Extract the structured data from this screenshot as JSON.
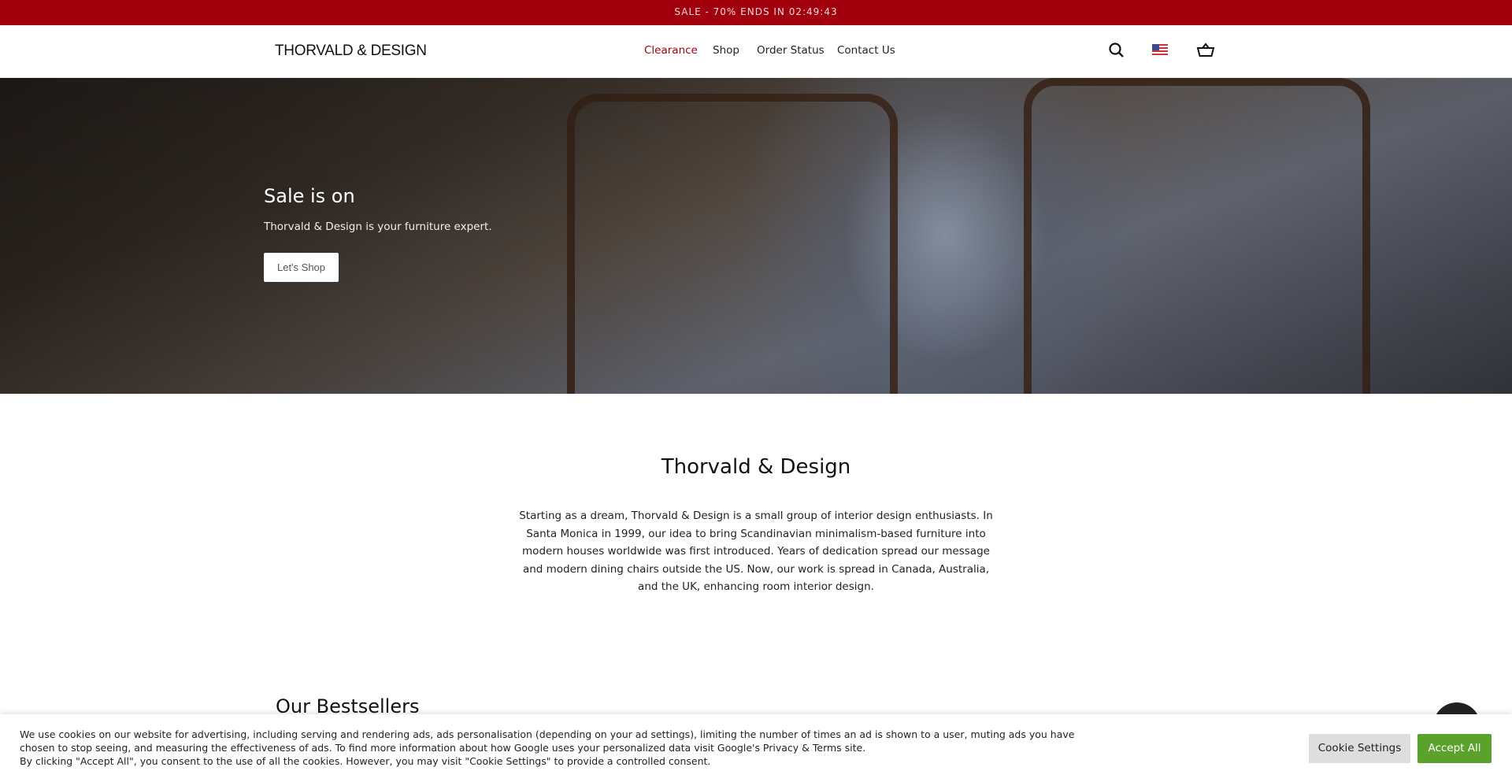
{
  "announcement": "SALE - 70% ENDS IN 02:49:43",
  "header": {
    "logo": "THORVALD & DESIGN",
    "nav": [
      {
        "label": "Clearance",
        "active": true
      },
      {
        "label": "Shop"
      },
      {
        "label": "Order Status"
      },
      {
        "label": "Contact Us"
      }
    ],
    "icons": [
      "search-icon",
      "us-flag-icon",
      "cart-icon"
    ]
  },
  "hero": {
    "title": "Sale is on",
    "subtitle": "Thorvald & Design is your furniture expert.",
    "button": "Let's Shop"
  },
  "about": {
    "title": "Thorvald & Design",
    "text": "Starting as a dream, Thorvald & Design is a small group of interior design enthusiasts. In Santa Monica in 1999, our idea to bring Scandinavian minimalism-based furniture into modern houses worldwide was first introduced. Years of dedication spread our message and modern dining chairs outside the US. Now, our work is spread in Canada, Australia, and the UK, enhancing room interior design."
  },
  "bestsellers": {
    "title": "Our Bestsellers"
  },
  "cookie": {
    "line1": "We use cookies on our website for advertising, including serving and rendering ads, ads personalisation (depending on your ad settings), limiting the number of times an ad is shown to a user, muting ads you have chosen to stop seeing, and measuring the effectiveness of ads. To find more information about how Google uses your personalized data visit Google's Privacy & Terms site.",
    "line2": "By clicking \"Accept All\", you consent to the use of all the cookies. However, you may visit \"Cookie Settings\" to provide a controlled consent.",
    "settings": "Cookie Settings",
    "accept": "Accept All"
  },
  "colors": {
    "brand_red": "#a3000e",
    "accept_green": "#5aa22c",
    "settings_gray": "#dedede"
  }
}
